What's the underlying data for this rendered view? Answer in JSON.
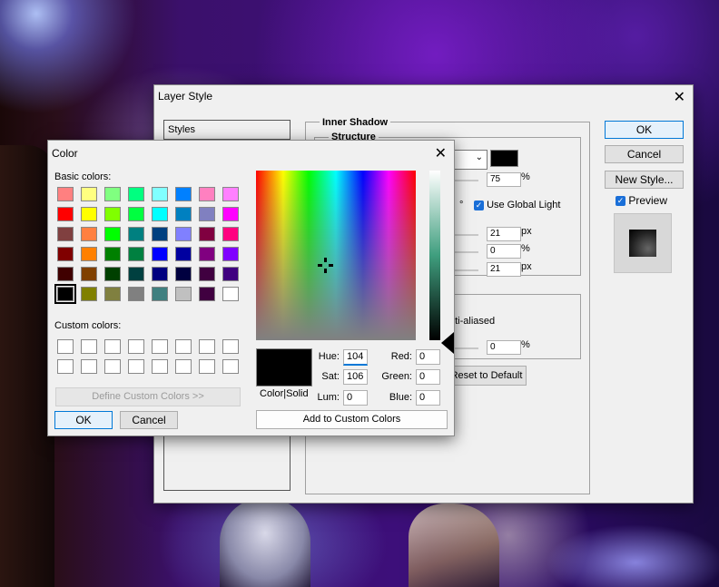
{
  "layer_style": {
    "title": "Layer Style",
    "styles_header": "Styles",
    "section_title": "Inner Shadow",
    "structure_title": "Structure",
    "opacity_value": "75",
    "percent_unit": "%",
    "degree_symbol": "°",
    "use_global_light": "Use Global Light",
    "distance_value": "21",
    "choke_value": "0",
    "size_value": "21",
    "px_unit": "px",
    "anti_aliased": "nti-aliased",
    "noise_value": "0",
    "reset_label": "Reset to Default",
    "ok_label": "OK",
    "cancel_label": "Cancel",
    "new_style_label": "New Style...",
    "preview_label": "Preview",
    "close_glyph": "✕"
  },
  "color_dialog": {
    "title": "Color",
    "close_glyph": "✕",
    "basic_colors_label": "Basic colors:",
    "custom_colors_label": "Custom colors:",
    "define_custom_label": "Define Custom Colors >>",
    "ok_label": "OK",
    "cancel_label": "Cancel",
    "color_solid_label": "Color|Solid",
    "add_custom_label": "Add to Custom Colors",
    "hue_label": "Hue:",
    "hue_value": "104",
    "sat_label": "Sat:",
    "sat_value": "106",
    "lum_label": "Lum:",
    "lum_value": "0",
    "red_label": "Red:",
    "red_value": "0",
    "green_label": "Green:",
    "green_value": "0",
    "blue_label": "Blue:",
    "blue_value": "0",
    "basic_colors": [
      "#ff8080",
      "#ffff80",
      "#80ff80",
      "#00ff80",
      "#80ffff",
      "#0080ff",
      "#ff80c0",
      "#ff80ff",
      "#ff0000",
      "#ffff00",
      "#80ff00",
      "#00ff40",
      "#00ffff",
      "#0080c0",
      "#8080c0",
      "#ff00ff",
      "#804040",
      "#ff8040",
      "#00ff00",
      "#008080",
      "#004080",
      "#8080ff",
      "#800040",
      "#ff0080",
      "#800000",
      "#ff8000",
      "#008000",
      "#008040",
      "#0000ff",
      "#0000a0",
      "#800080",
      "#8000ff",
      "#400000",
      "#804000",
      "#004000",
      "#004040",
      "#000080",
      "#000040",
      "#400040",
      "#400080",
      "#000000",
      "#808000",
      "#808040",
      "#808080",
      "#408080",
      "#c0c0c0",
      "#400040",
      "#ffffff"
    ],
    "selected_basic_index": 40
  }
}
